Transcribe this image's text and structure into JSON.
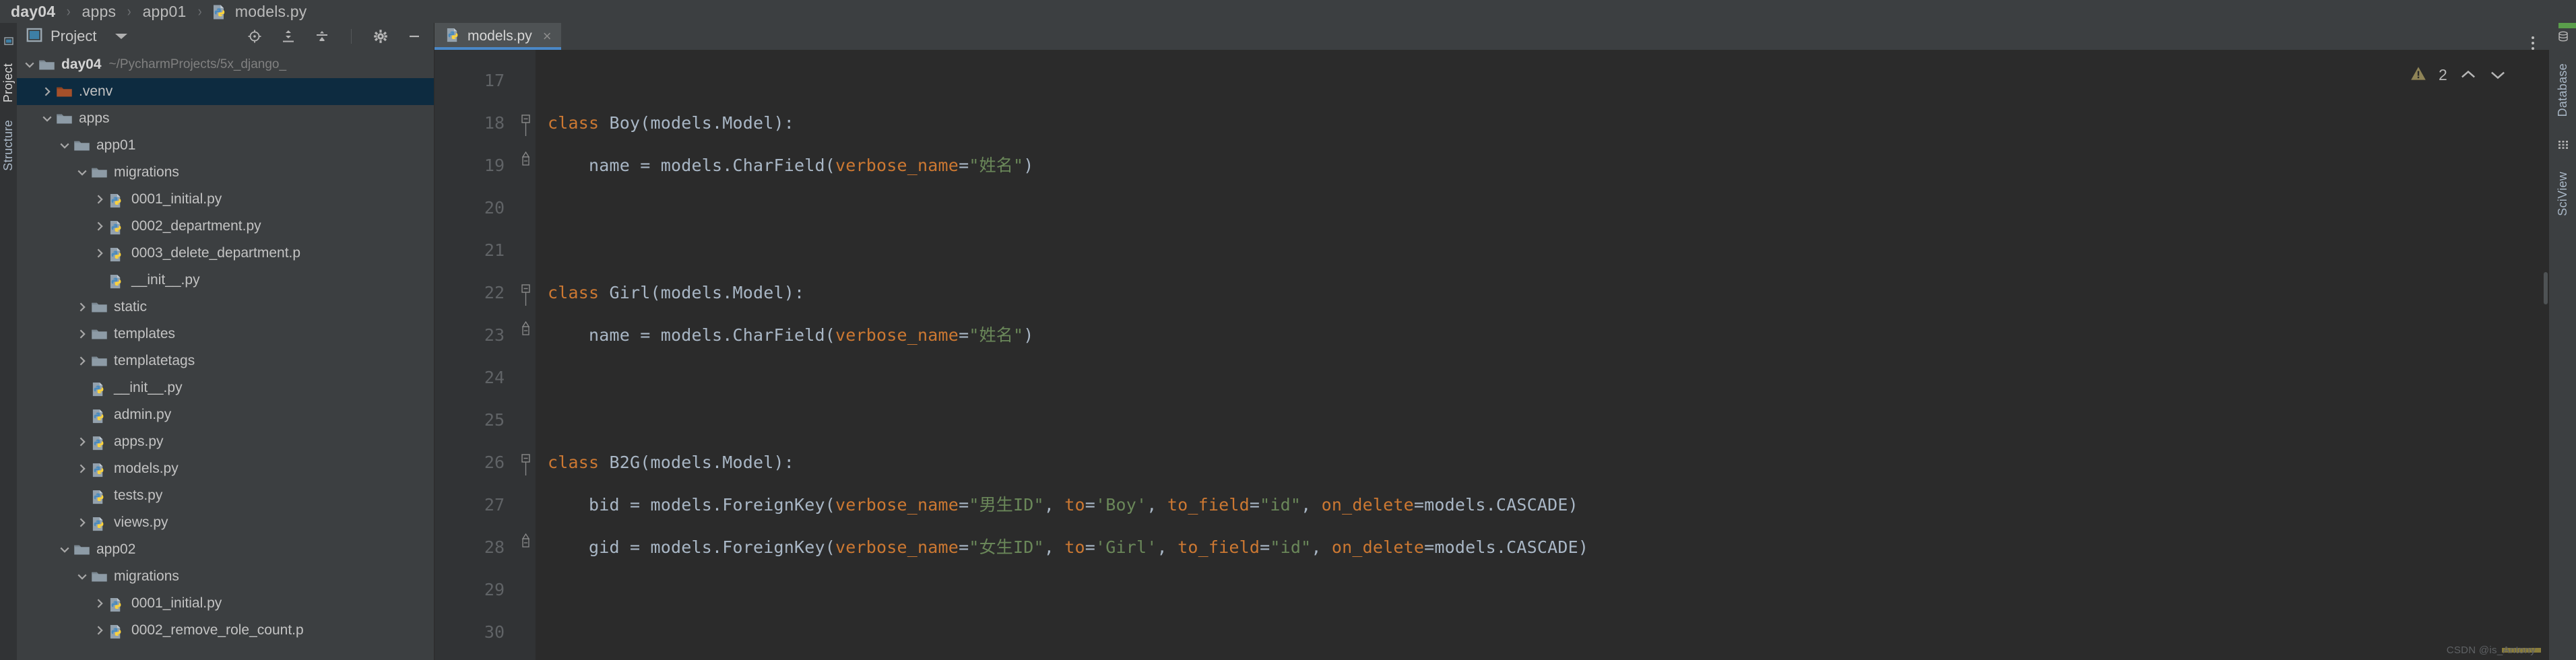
{
  "breadcrumb": {
    "items": [
      {
        "label": "day04",
        "bold": true,
        "icon": null
      },
      {
        "label": "apps",
        "bold": false,
        "icon": null
      },
      {
        "label": "app01",
        "bold": false,
        "icon": null
      },
      {
        "label": "models.py",
        "bold": false,
        "icon": "python-file-icon"
      }
    ],
    "separator": "›"
  },
  "left_stripe": {
    "items": [
      {
        "label": "Project",
        "selected": true
      },
      {
        "label": "Structure",
        "selected": false
      }
    ]
  },
  "project_panel": {
    "title": "Project",
    "dropdown_icon": "chevron-down-icon",
    "toolbar": [
      {
        "name": "locate-icon",
        "title": "Select Opened File"
      },
      {
        "name": "expand-all-icon",
        "title": "Expand All"
      },
      {
        "name": "collapse-all-icon",
        "title": "Collapse All"
      },
      {
        "name": "gear-icon",
        "title": "Options"
      },
      {
        "name": "minimize-icon",
        "title": "Hide"
      }
    ],
    "tree": [
      {
        "indent": 0,
        "arrow": "down",
        "icon": "folder",
        "label": "day04",
        "bold": true,
        "path": "~/PycharmProjects/5x_django_",
        "selected": false
      },
      {
        "indent": 1,
        "arrow": "right",
        "icon": "folder-orange",
        "label": ".venv",
        "bold": false,
        "path": "",
        "selected": true
      },
      {
        "indent": 1,
        "arrow": "down",
        "icon": "folder",
        "label": "apps",
        "bold": false,
        "path": "",
        "selected": false
      },
      {
        "indent": 2,
        "arrow": "down",
        "icon": "folder",
        "label": "app01",
        "bold": false,
        "path": "",
        "selected": false
      },
      {
        "indent": 3,
        "arrow": "down",
        "icon": "folder",
        "label": "migrations",
        "bold": false,
        "path": "",
        "selected": false
      },
      {
        "indent": 4,
        "arrow": "right",
        "icon": "python",
        "label": "0001_initial.py",
        "bold": false,
        "path": "",
        "selected": false
      },
      {
        "indent": 4,
        "arrow": "right",
        "icon": "python",
        "label": "0002_department.py",
        "bold": false,
        "path": "",
        "selected": false
      },
      {
        "indent": 4,
        "arrow": "right",
        "icon": "python",
        "label": "0003_delete_department.p",
        "bold": false,
        "path": "",
        "selected": false
      },
      {
        "indent": 4,
        "arrow": "none",
        "icon": "python",
        "label": "__init__.py",
        "bold": false,
        "path": "",
        "selected": false
      },
      {
        "indent": 3,
        "arrow": "right",
        "icon": "folder",
        "label": "static",
        "bold": false,
        "path": "",
        "selected": false
      },
      {
        "indent": 3,
        "arrow": "right",
        "icon": "folder",
        "label": "templates",
        "bold": false,
        "path": "",
        "selected": false
      },
      {
        "indent": 3,
        "arrow": "right",
        "icon": "folder",
        "label": "templatetags",
        "bold": false,
        "path": "",
        "selected": false
      },
      {
        "indent": 3,
        "arrow": "none",
        "icon": "python",
        "label": "__init__.py",
        "bold": false,
        "path": "",
        "selected": false
      },
      {
        "indent": 3,
        "arrow": "none",
        "icon": "python",
        "label": "admin.py",
        "bold": false,
        "path": "",
        "selected": false
      },
      {
        "indent": 3,
        "arrow": "right",
        "icon": "python",
        "label": "apps.py",
        "bold": false,
        "path": "",
        "selected": false
      },
      {
        "indent": 3,
        "arrow": "right",
        "icon": "python",
        "label": "models.py",
        "bold": false,
        "path": "",
        "selected": false
      },
      {
        "indent": 3,
        "arrow": "none",
        "icon": "python",
        "label": "tests.py",
        "bold": false,
        "path": "",
        "selected": false
      },
      {
        "indent": 3,
        "arrow": "right",
        "icon": "python",
        "label": "views.py",
        "bold": false,
        "path": "",
        "selected": false
      },
      {
        "indent": 2,
        "arrow": "down",
        "icon": "folder",
        "label": "app02",
        "bold": false,
        "path": "",
        "selected": false
      },
      {
        "indent": 3,
        "arrow": "down",
        "icon": "folder",
        "label": "migrations",
        "bold": false,
        "path": "",
        "selected": false
      },
      {
        "indent": 4,
        "arrow": "right",
        "icon": "python",
        "label": "0001_initial.py",
        "bold": false,
        "path": "",
        "selected": false
      },
      {
        "indent": 4,
        "arrow": "right",
        "icon": "python",
        "label": "0002_remove_role_count.p",
        "bold": false,
        "path": "",
        "selected": false
      }
    ]
  },
  "editor": {
    "tabs": [
      {
        "label": "models.py",
        "icon": "python-file-icon",
        "active": true,
        "close_icon": "×"
      }
    ],
    "overflow_icon": "kebab-menu-icon",
    "first_line_number": 17,
    "lines": [
      {
        "n": 17,
        "fold": "none",
        "tokens": []
      },
      {
        "n": 18,
        "fold": "start",
        "tokens": [
          {
            "t": "class ",
            "c": "kw"
          },
          {
            "t": "Boy",
            "c": "cls"
          },
          {
            "t": "(models.Model):",
            "c": "punc"
          }
        ]
      },
      {
        "n": 19,
        "fold": "mid",
        "tokens": [
          {
            "t": "    name = models.CharField(",
            "c": "id"
          },
          {
            "t": "verbose_name",
            "c": "kwarg"
          },
          {
            "t": "=",
            "c": "punc"
          },
          {
            "t": "\"姓名\"",
            "c": "str"
          },
          {
            "t": ")",
            "c": "punc"
          }
        ]
      },
      {
        "n": 20,
        "fold": "none",
        "tokens": []
      },
      {
        "n": 21,
        "fold": "none",
        "tokens": []
      },
      {
        "n": 22,
        "fold": "start",
        "tokens": [
          {
            "t": "class ",
            "c": "kw"
          },
          {
            "t": "Girl",
            "c": "cls"
          },
          {
            "t": "(models.Model):",
            "c": "punc"
          }
        ]
      },
      {
        "n": 23,
        "fold": "mid",
        "tokens": [
          {
            "t": "    name = models.CharField(",
            "c": "id"
          },
          {
            "t": "verbose_name",
            "c": "kwarg"
          },
          {
            "t": "=",
            "c": "punc"
          },
          {
            "t": "\"姓名\"",
            "c": "str"
          },
          {
            "t": ")",
            "c": "punc"
          }
        ]
      },
      {
        "n": 24,
        "fold": "none",
        "tokens": []
      },
      {
        "n": 25,
        "fold": "none",
        "tokens": []
      },
      {
        "n": 26,
        "fold": "start",
        "tokens": [
          {
            "t": "class ",
            "c": "kw"
          },
          {
            "t": "B2G",
            "c": "cls"
          },
          {
            "t": "(models.Model):",
            "c": "punc"
          }
        ]
      },
      {
        "n": 27,
        "fold": "none",
        "tokens": [
          {
            "t": "    bid = models.ForeignKey(",
            "c": "id"
          },
          {
            "t": "verbose_name",
            "c": "kwarg"
          },
          {
            "t": "=",
            "c": "punc"
          },
          {
            "t": "\"男生ID\"",
            "c": "str"
          },
          {
            "t": ", ",
            "c": "punc"
          },
          {
            "t": "to",
            "c": "kwarg"
          },
          {
            "t": "=",
            "c": "punc"
          },
          {
            "t": "'Boy'",
            "c": "str"
          },
          {
            "t": ", ",
            "c": "punc"
          },
          {
            "t": "to_field",
            "c": "kwarg"
          },
          {
            "t": "=",
            "c": "punc"
          },
          {
            "t": "\"id\"",
            "c": "str"
          },
          {
            "t": ", ",
            "c": "punc"
          },
          {
            "t": "on_delete",
            "c": "kwarg"
          },
          {
            "t": "=",
            "c": "punc"
          },
          {
            "t": "models.CASCADE)",
            "c": "id"
          }
        ]
      },
      {
        "n": 28,
        "fold": "mid",
        "tokens": [
          {
            "t": "    gid = models.ForeignKey(",
            "c": "id"
          },
          {
            "t": "verbose_name",
            "c": "kwarg"
          },
          {
            "t": "=",
            "c": "punc"
          },
          {
            "t": "\"女生ID\"",
            "c": "str"
          },
          {
            "t": ", ",
            "c": "punc"
          },
          {
            "t": "to",
            "c": "kwarg"
          },
          {
            "t": "=",
            "c": "punc"
          },
          {
            "t": "'Girl'",
            "c": "str"
          },
          {
            "t": ", ",
            "c": "punc"
          },
          {
            "t": "to_field",
            "c": "kwarg"
          },
          {
            "t": "=",
            "c": "punc"
          },
          {
            "t": "\"id\"",
            "c": "str"
          },
          {
            "t": ", ",
            "c": "punc"
          },
          {
            "t": "on_delete",
            "c": "kwarg"
          },
          {
            "t": "=",
            "c": "punc"
          },
          {
            "t": "models.CASCADE)",
            "c": "id"
          }
        ]
      },
      {
        "n": 29,
        "fold": "none",
        "tokens": []
      },
      {
        "n": 30,
        "fold": "none",
        "tokens": []
      }
    ]
  },
  "inspection": {
    "warning_icon": "warning-triangle-icon",
    "warning_count": "2",
    "prev_icon": "chevron-up-icon",
    "next_icon": "chevron-down-icon"
  },
  "right_stripe": {
    "items": [
      {
        "label": "Database",
        "icon": "database-icon"
      },
      {
        "label": "SciView",
        "icon": "grid-icon"
      }
    ]
  },
  "watermark": "CSDN @is_Antony",
  "colors": {
    "bg_panel": "#3c3f41",
    "bg_editor": "#2b2b2b",
    "bg_gutter": "#313335",
    "selection": "#0d2b40",
    "tab_active": "#4e5254",
    "tab_underline": "#4a88c7",
    "keyword": "#cc7832",
    "string": "#6a8759",
    "text": "#a9b7c6",
    "folder_orange": "#a5502a",
    "warning": "#8a7c3a"
  }
}
